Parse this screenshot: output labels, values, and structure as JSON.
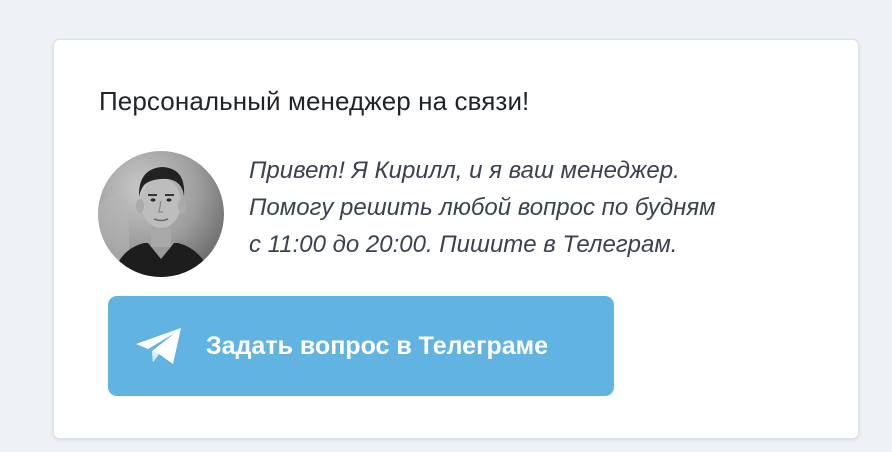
{
  "card": {
    "title": "Персональный менеджер на связи!",
    "message_lines": [
      "Привет! Я Кирилл, и я ваш менеджер.",
      "Помогу решить любой вопрос по будням",
      "с 11:00 до 20:00. Пишите в Телеграм."
    ],
    "avatar_icon": "manager-photo",
    "button": {
      "label": "Задать вопрос в Телеграме",
      "icon": "paper-plane-icon"
    }
  },
  "colors": {
    "page_background": "#eef1f5",
    "card_background": "#ffffff",
    "title_text": "#1f242b",
    "message_text": "#3a4250",
    "button_background": "#61b3e2",
    "button_text": "#ffffff"
  }
}
